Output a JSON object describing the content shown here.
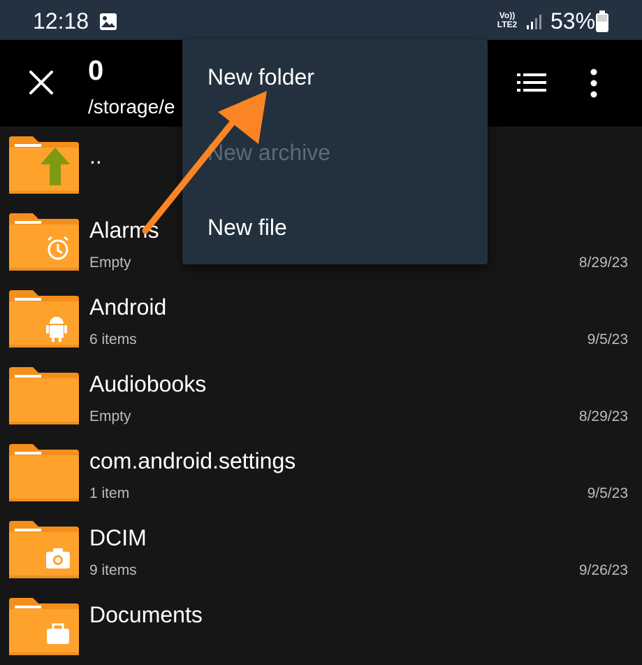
{
  "status_bar": {
    "time": "12:18",
    "volte_line1": "Vo))",
    "volte_line2": "LTE2",
    "battery": "53%",
    "background": "#233141"
  },
  "toolbar": {
    "count": "0",
    "path": "/storage/e",
    "close_icon": "close-icon",
    "view_icon": "list-view-icon",
    "more_icon": "more-vert-icon"
  },
  "files": [
    {
      "name": "..",
      "meta": "",
      "date": "",
      "badge": "up-arrow"
    },
    {
      "name": "Alarms",
      "meta": "Empty",
      "date": "8/29/23",
      "badge": "alarm"
    },
    {
      "name": "Android",
      "meta": "6 items",
      "date": "9/5/23",
      "badge": "android"
    },
    {
      "name": "Audiobooks",
      "meta": "Empty",
      "date": "8/29/23",
      "badge": ""
    },
    {
      "name": "com.android.settings",
      "meta": "1 item",
      "date": "9/5/23",
      "badge": ""
    },
    {
      "name": "DCIM",
      "meta": "9 items",
      "date": "9/26/23",
      "badge": "camera"
    },
    {
      "name": "Documents",
      "meta": "",
      "date": "",
      "badge": "briefcase"
    }
  ],
  "menu": {
    "items": [
      {
        "label": "New folder",
        "enabled": true
      },
      {
        "label": "New archive",
        "enabled": false
      },
      {
        "label": "New file",
        "enabled": true
      }
    ],
    "background": "#22313d"
  },
  "colors": {
    "folder": "#ffa22b",
    "folder_tab": "#f58f1c",
    "annotation_arrow": "#fb8524",
    "up_arrow": "#7f9a11"
  }
}
